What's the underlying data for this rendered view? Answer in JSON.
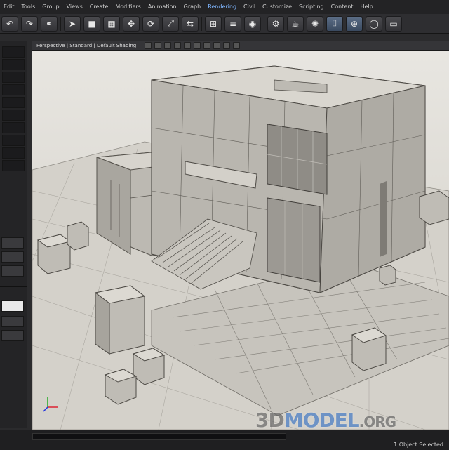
{
  "menu": {
    "items": [
      "Edit",
      "Tools",
      "Group",
      "Views",
      "Create",
      "Modifiers",
      "Animation",
      "Graph",
      "Rendering",
      "Civil",
      "Customize",
      "Scripting",
      "Content",
      "Help"
    ],
    "active_index": 8
  },
  "toolbar": {
    "buttons": [
      {
        "icon": "undo-icon",
        "glyph": "↶"
      },
      {
        "icon": "redo-icon",
        "glyph": "↷"
      },
      {
        "icon": "link-icon",
        "glyph": "⚭"
      },
      {
        "icon": "select-icon",
        "glyph": "➤"
      },
      {
        "icon": "box-icon",
        "glyph": "■"
      },
      {
        "icon": "grid-icon",
        "glyph": "▦"
      },
      {
        "icon": "move-icon",
        "glyph": "✥"
      },
      {
        "icon": "rotate-icon",
        "glyph": "⟳"
      },
      {
        "icon": "scale-icon",
        "glyph": "⤢"
      },
      {
        "icon": "mirror-icon",
        "glyph": "⇆"
      },
      {
        "icon": "align-icon",
        "glyph": "⊞"
      },
      {
        "icon": "layer-icon",
        "glyph": "≡"
      },
      {
        "icon": "material-icon",
        "glyph": "◉"
      },
      {
        "icon": "render-setup-icon",
        "glyph": "⚙"
      },
      {
        "icon": "render-icon",
        "glyph": "☕"
      },
      {
        "icon": "light-icon",
        "glyph": "✺"
      },
      {
        "icon": "camera-icon",
        "glyph": "⌷"
      },
      {
        "icon": "snap-icon",
        "glyph": "⊕"
      },
      {
        "icon": "ring-icon",
        "glyph": "◯"
      },
      {
        "icon": "window-icon",
        "glyph": "▭"
      }
    ]
  },
  "viewport": {
    "label": "Perspective | Standard | Default Shading"
  },
  "watermark": {
    "part1": "3D",
    "part2": "MODEL",
    "part3": ".ORG"
  },
  "status": {
    "text": "1 Object Selected"
  },
  "colors": {
    "accent": "#7fb6ff",
    "viewport_bg": "#d9d7d1",
    "concrete": "#c9c6bf"
  }
}
